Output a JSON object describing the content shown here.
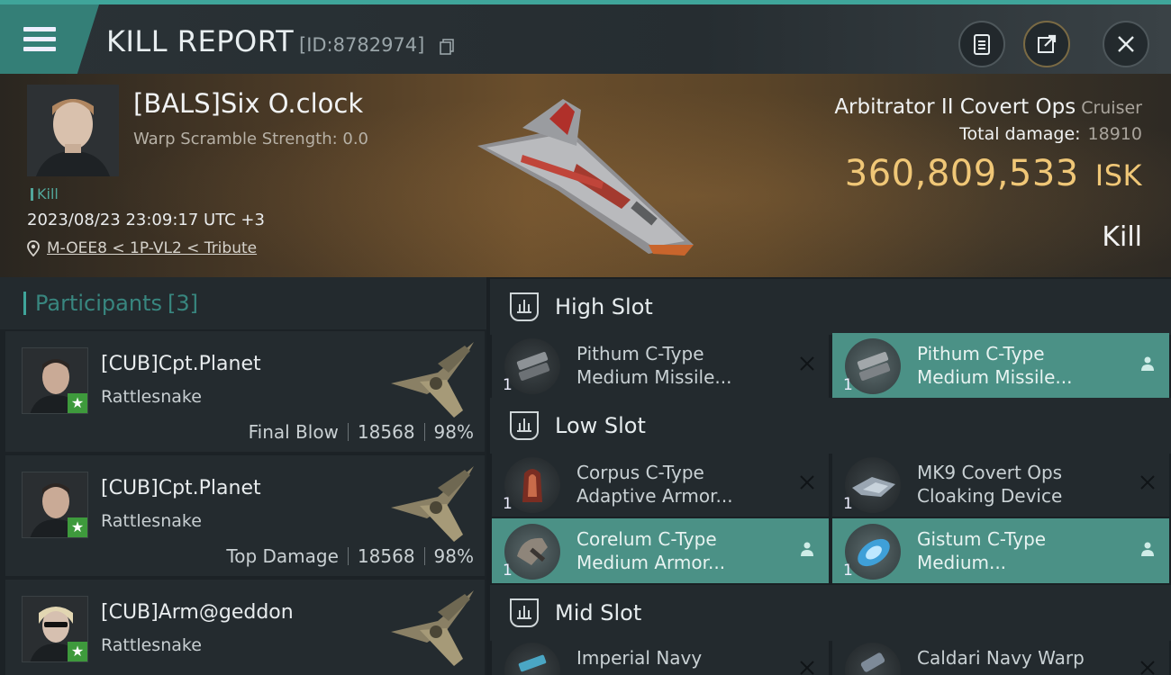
{
  "header": {
    "title": "KILL REPORT",
    "report_id": "[ID:8782974]",
    "icons": [
      "menu-icon",
      "copy-icon",
      "clipboard-icon",
      "share-icon",
      "close-icon"
    ]
  },
  "victim": {
    "name": "[BALS]Six O.clock",
    "warp_scramble": "Warp Scramble Strength: 0.0",
    "type_tag": "Kill",
    "datetime": "2023/08/23 23:09:17 UTC +3",
    "location": "M-OEE8 < 1P-VL2 < Tribute",
    "ship_name": "Arbitrator II Covert Ops",
    "ship_class": "Cruiser",
    "total_damage_label": "Total damage:",
    "total_damage": "18910",
    "isk_value": "360,809,533",
    "isk_unit": "ISK",
    "result": "Kill"
  },
  "participants": {
    "label": "Participants",
    "count": "[3]",
    "items": [
      {
        "name": "[CUB]Cpt.Planet",
        "ship": "Rattlesnake",
        "role": "Final Blow",
        "damage": "18568",
        "percent": "98%"
      },
      {
        "name": "[CUB]Cpt.Planet",
        "ship": "Rattlesnake",
        "role": "Top Damage",
        "damage": "18568",
        "percent": "98%"
      },
      {
        "name": "[CUB]Arm@geddon",
        "ship": "Rattlesnake",
        "role": "",
        "damage": "",
        "percent": ""
      }
    ]
  },
  "slots": {
    "high": {
      "label": "High Slot",
      "modules": [
        {
          "name1": "Pithum C-Type",
          "name2": "Medium Missile...",
          "qty": "1",
          "state": "destroyed"
        },
        {
          "name1": "Pithum C-Type",
          "name2": "Medium Missile...",
          "qty": "1",
          "state": "dropped"
        }
      ]
    },
    "low": {
      "label": "Low Slot",
      "modules": [
        {
          "name1": "Corpus C-Type",
          "name2": "Adaptive Armor...",
          "qty": "1",
          "state": "destroyed"
        },
        {
          "name1": "MK9 Covert Ops",
          "name2": "Cloaking Device",
          "qty": "1",
          "state": "destroyed"
        },
        {
          "name1": "Corelum C-Type",
          "name2": "Medium Armor...",
          "qty": "1",
          "state": "dropped"
        },
        {
          "name1": "Gistum C-Type",
          "name2": "Medium...",
          "qty": "1",
          "state": "dropped"
        }
      ]
    },
    "mid": {
      "label": "Mid Slot",
      "modules": [
        {
          "name1": "Imperial Navy",
          "name2": "",
          "qty": "",
          "state": "destroyed"
        },
        {
          "name1": "Caldari Navy Warp",
          "name2": "",
          "qty": "",
          "state": "destroyed"
        }
      ]
    }
  },
  "colors": {
    "accent": "#3fa59a",
    "isk": "#f0c777",
    "fitted": "#4b9186"
  }
}
